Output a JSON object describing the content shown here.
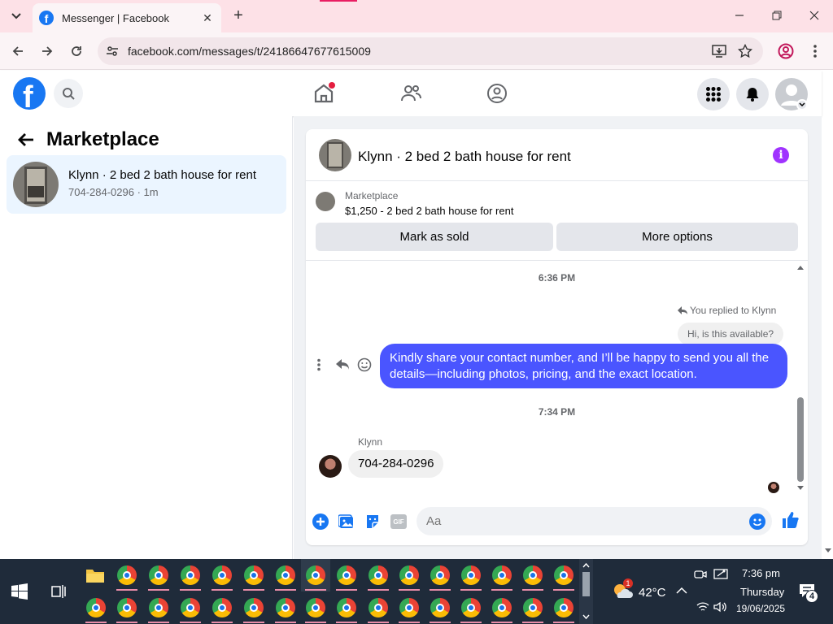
{
  "browser": {
    "tab_title": "Messenger | Facebook",
    "favicon_letter": "f",
    "url": "facebook.com/messages/t/24186647677615009",
    "new_tab_symbol": "+"
  },
  "fb": {
    "logo_letter": "f"
  },
  "left_panel": {
    "title": "Marketplace",
    "conversation": {
      "name": "Klynn · 2 bed 2 bath house for rent",
      "subtitle": "704-284-0296 · 1m"
    }
  },
  "chat": {
    "header_title": "Klynn · 2 bed 2 bath house for rent",
    "info_symbol": "i",
    "listing_label": "Marketplace",
    "listing_price_title": "$1,250 - 2 bed 2 bath house for rent",
    "mark_sold_label": "Mark as sold",
    "more_options_label": "More options",
    "timestamp_1": "6:36 PM",
    "replied_label": "You replied to Klynn",
    "quoted_text": "Hi, is this available?",
    "my_message": "Kindly share your contact number, and I’ll be happy to send you all the details—including photos, pricing, and the exact location.",
    "timestamp_2": "7:34 PM",
    "sender_name": "Klynn",
    "their_message": "704-284-0296",
    "input_placeholder": "Aa",
    "gif_label": "GIF"
  },
  "taskbar": {
    "temperature": "42°C",
    "time": "7:36 pm",
    "day": "Thursday",
    "date": "19/06/2025",
    "notification_count": "4",
    "weather_badge": "1"
  },
  "colors": {
    "fb_blue": "#1877f2",
    "bubble_blue": "#4a55ff",
    "info_purple": "#a033ff",
    "tab_bar": "#fde1e7"
  }
}
